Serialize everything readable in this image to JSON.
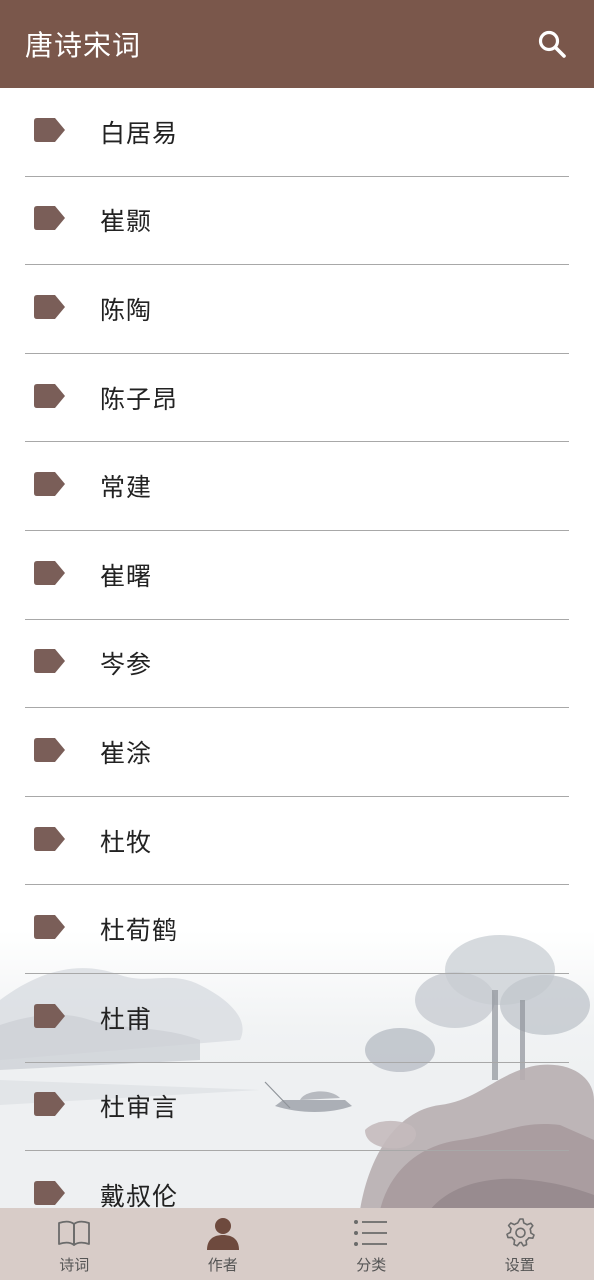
{
  "header": {
    "title": "唐诗宋词",
    "search_icon": "search-icon"
  },
  "authors": [
    {
      "name": "白居易"
    },
    {
      "name": "崔颢"
    },
    {
      "name": "陈陶"
    },
    {
      "name": "陈子昂"
    },
    {
      "name": "常建"
    },
    {
      "name": "崔曙"
    },
    {
      "name": "岑参"
    },
    {
      "name": "崔涂"
    },
    {
      "name": "杜牧"
    },
    {
      "name": "杜荀鹤"
    },
    {
      "name": "杜甫"
    },
    {
      "name": "杜审言"
    },
    {
      "name": "戴叔伦"
    }
  ],
  "bottom_nav": {
    "tabs": [
      {
        "label": "诗词",
        "icon": "book-icon",
        "active": false
      },
      {
        "label": "作者",
        "icon": "person-icon",
        "active": true
      },
      {
        "label": "分类",
        "icon": "list-icon",
        "active": false
      },
      {
        "label": "设置",
        "icon": "gear-icon",
        "active": false
      }
    ]
  },
  "colors": {
    "app_bar": "#7a574b",
    "tag_icon": "#7a5e58",
    "bottom_nav_bg": "#d8ccc8",
    "divider": "#a8a8a8"
  }
}
